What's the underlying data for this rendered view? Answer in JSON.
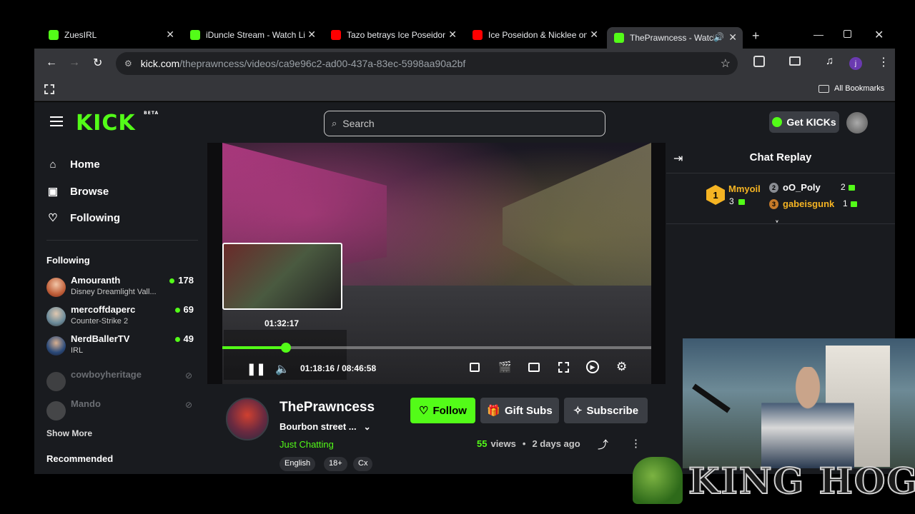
{
  "tabs": [
    {
      "title": "ZuesIRL",
      "icon": "kick-icon",
      "color": "#53fc18"
    },
    {
      "title": "iDuncle Stream - Watch Li",
      "icon": "kick-icon",
      "color": "#53fc18"
    },
    {
      "title": "Tazo betrays Ice Poseidon",
      "icon": "youtube-icon",
      "color": "#ff0000"
    },
    {
      "title": "Ice Poseidon & Nicklee on",
      "icon": "youtube-icon",
      "color": "#ff0000"
    },
    {
      "title": "ThePrawncess - Watch",
      "icon": "kick-icon",
      "color": "#53fc18"
    }
  ],
  "address": {
    "domain": "kick.com",
    "path": "/theprawncess/videos/ca9e96c2-ad00-437a-83ec-5998aa90a2bf"
  },
  "bookmarks": {
    "all": "All Bookmarks"
  },
  "kick": {
    "logo": "KICK",
    "beta": "BETA",
    "search_placeholder": "Search",
    "get_kicks": "Get KICKs"
  },
  "nav": {
    "home": "Home",
    "browse": "Browse",
    "following": "Following"
  },
  "sidebar": {
    "following_heading": "Following",
    "channels": [
      {
        "name": "Amouranth",
        "game": "Disney Dreamlight Vall...",
        "viewers": "178",
        "live": true
      },
      {
        "name": "mercoffdaperc",
        "game": "Counter-Strike 2",
        "viewers": "69",
        "live": true
      },
      {
        "name": "NerdBallerTV",
        "game": "IRL",
        "viewers": "49",
        "live": true
      },
      {
        "name": "cowboyheritage",
        "game": "",
        "viewers": "",
        "live": false
      },
      {
        "name": "Mando",
        "game": "",
        "viewers": "",
        "live": false
      }
    ],
    "show_more": "Show More",
    "recommended": "Recommended"
  },
  "player": {
    "preview_time": "01:32:17",
    "current_time": "01:18:16",
    "separator": "/",
    "duration": "08:46:58",
    "progress": 0.1484
  },
  "channel": {
    "name": "ThePrawncess",
    "title": "Bourbon street ...",
    "category": "Just Chatting",
    "follow": "Follow",
    "gift_subs": "Gift Subs",
    "subscribe": "Subscribe",
    "views_count": "55",
    "views_label": "views",
    "dot": "•",
    "age": "2 days ago",
    "tags": [
      "English",
      "18+",
      "Cx"
    ]
  },
  "chat": {
    "title": "Chat Replay",
    "leaders": [
      {
        "rank": "1",
        "name": "Mmyoil",
        "count": "3"
      },
      {
        "rank": "2",
        "name": "oO_Poly",
        "count": "2"
      },
      {
        "rank": "3",
        "name": "gabeisgunk",
        "count": "1"
      }
    ]
  },
  "overlay": {
    "text": "KING HOG"
  },
  "colors": {
    "accent": "#53fc18",
    "bg": "#191b1f",
    "gold": "#f5b423"
  }
}
